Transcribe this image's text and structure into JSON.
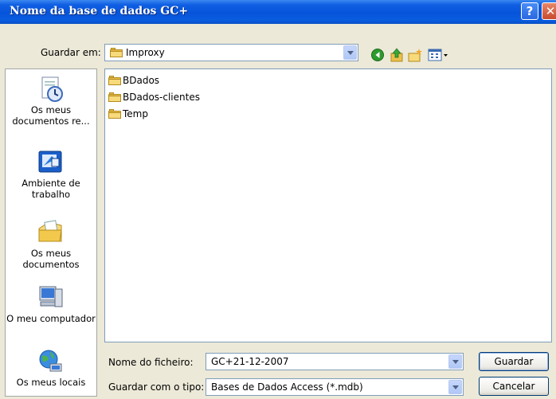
{
  "window": {
    "title": "Nome da base de dados GC+",
    "help_glyph": "?",
    "close_glyph": "✕"
  },
  "savein": {
    "label": "Guardar em:",
    "value": "Improxy"
  },
  "toolbar": {
    "icons": [
      "back-icon",
      "up-folder-icon",
      "new-folder-icon",
      "views-menu-icon"
    ]
  },
  "places": [
    {
      "label": "Os meus documentos re...",
      "icon": "recent-documents-icon"
    },
    {
      "label": "Ambiente de trabalho",
      "icon": "desktop-icon"
    },
    {
      "label": "Os meus documentos",
      "icon": "my-documents-icon"
    },
    {
      "label": "O meu computador",
      "icon": "my-computer-icon"
    },
    {
      "label": "Os meus locais",
      "icon": "network-places-icon"
    }
  ],
  "files": [
    {
      "name": "BDados"
    },
    {
      "name": "BDados-clientes"
    },
    {
      "name": "Temp"
    }
  ],
  "filename": {
    "label": "Nome do ficheiro:",
    "value": "GC+21-12-2007"
  },
  "filetype": {
    "label": "Guardar com o tipo:",
    "value": "Bases de Dados Access (*.mdb)"
  },
  "buttons": {
    "save": "Guardar",
    "cancel": "Cancelar"
  },
  "colors": {
    "titlebar": "#0654d9",
    "dialog_bg": "#ece9d8",
    "field_border": "#7f9db9"
  }
}
